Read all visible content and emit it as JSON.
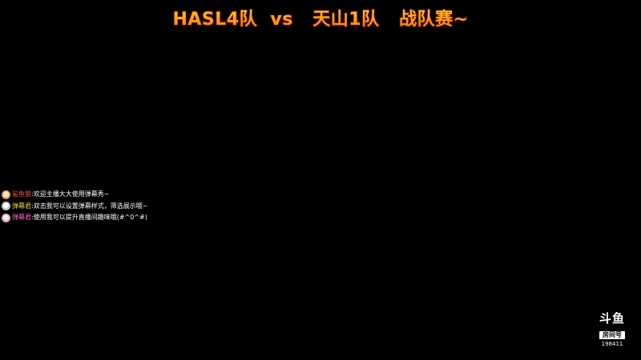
{
  "stream": {
    "title": "HASL4队  vs   天山1队   战队赛~"
  },
  "danmaku": [
    {
      "avatar": "user-avatar-icon",
      "nick": "鲨鱼狼",
      "nick_color": "#ff4a4a",
      "text": ":欢迎主播大大使用弹幕秀~"
    },
    {
      "avatar": "bot-avatar-icon",
      "nick": "弹幕君",
      "nick_color": "#ffd84a",
      "text": ":双击我可以设置弹幕样式，筛选展示哦~"
    },
    {
      "avatar": "bot-avatar-icon",
      "nick": "弹幕君",
      "nick_color": "#ff6ad5",
      "text": ":使用我可以提升直播间趣味哦(#^0^#)"
    }
  ],
  "watermark": {
    "brand": "斗鱼",
    "room_label": "房间号",
    "room_number": "198411"
  },
  "colors": {
    "background": "#000000",
    "title_gradient_top": "#ffd23a",
    "title_gradient_bottom": "#ff7a00"
  }
}
